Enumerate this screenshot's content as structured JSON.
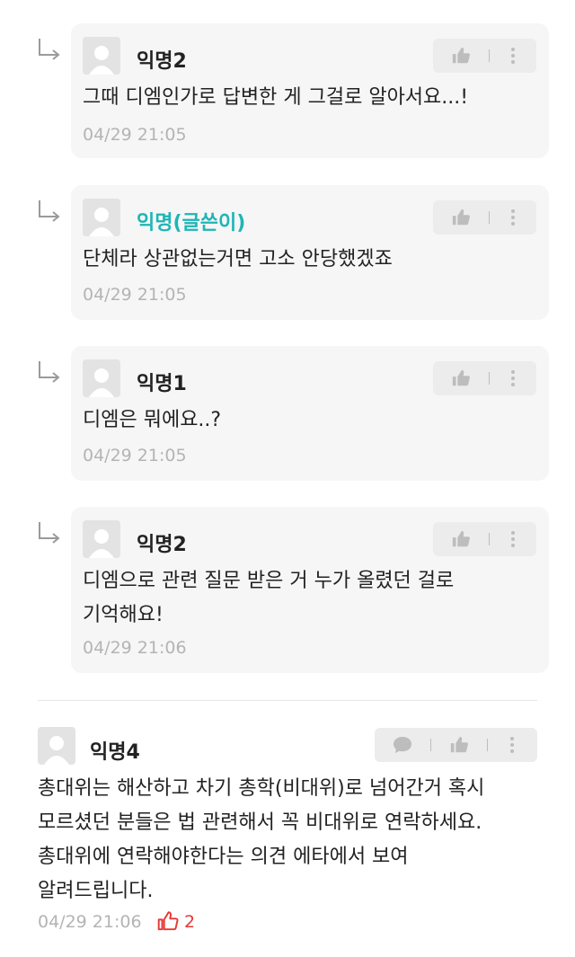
{
  "replies": [
    {
      "author": "익명2",
      "is_op": false,
      "body": "그때 디엠인가로 답변한 게 그걸로 알아서요...!",
      "time": "04/29 21:05"
    },
    {
      "author": "익명(글쓴이)",
      "is_op": true,
      "body": "단체라 상관없는거면 고소 안당했겠죠",
      "time": "04/29 21:05"
    },
    {
      "author": "익명1",
      "is_op": false,
      "body": "디엠은 뭐에요..?",
      "time": "04/29 21:05"
    },
    {
      "author": "익명2",
      "is_op": false,
      "body": "디엠으로 관련 질문 받은 거 누가 올렸던 걸로\n기억해요!",
      "time": "04/29 21:06"
    }
  ],
  "comment": {
    "author": "익명4",
    "body": "총대위는 해산하고 차기 총학(비대위)로 넘어간거 혹시\n모르셨던 분들은 법 관련해서 꼭 비대위로 연락하세요.\n총대위에 연락해야한다는 의견 에타에서 보여\n알려드립니다.",
    "time": "04/29 21:06",
    "likes": "2"
  },
  "colors": {
    "op_name": "#1fb5b5",
    "like_red": "#e53935",
    "card_bg": "#f6f6f6"
  },
  "icons": [
    "reply-arrow-icon",
    "thumbs-up-icon",
    "more-vertical-icon",
    "speech-bubble-icon",
    "avatar-icon"
  ]
}
